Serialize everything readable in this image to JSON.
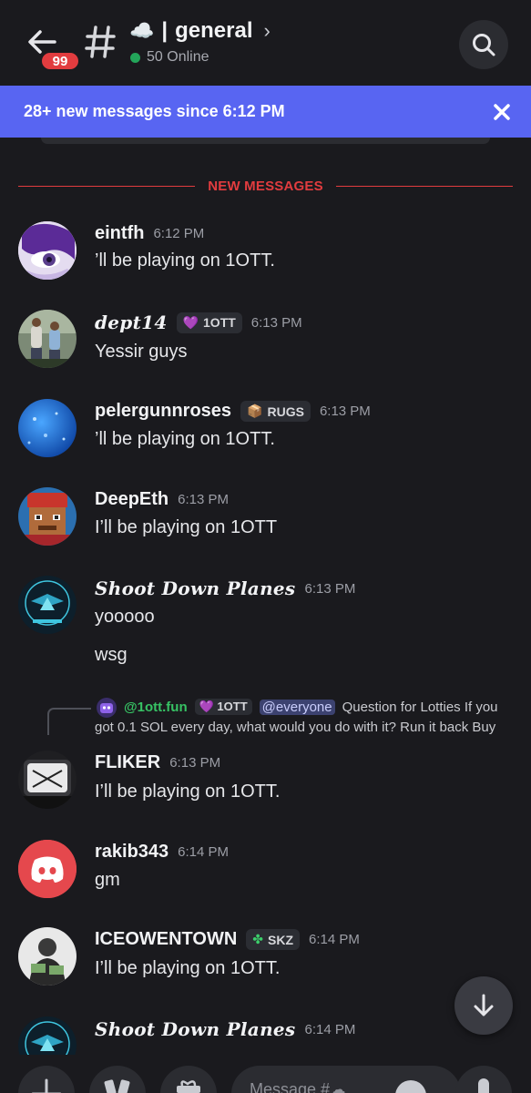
{
  "header": {
    "unread_count": "99",
    "channel_emoji": "☁️",
    "separator": "|",
    "channel_name": "general",
    "online_text": "50 Online"
  },
  "banner": {
    "text": "28+ new messages since 6:12 PM"
  },
  "divider": {
    "label": "NEW MESSAGES"
  },
  "messages": [
    {
      "username": "eintfh",
      "time": "6:12 PM",
      "lines": [
        "’ll be playing on 1OTT."
      ]
    },
    {
      "username": "dept14",
      "tag": "1OTT",
      "tag_icon": "purple-heart-icon",
      "time": "6:13 PM",
      "lines": [
        "Yessir guys"
      ]
    },
    {
      "username": "pelergunnroses",
      "tag": "RUGS",
      "tag_icon": "box-icon",
      "time": "6:13 PM",
      "lines": [
        "’ll be playing on 1OTT."
      ]
    },
    {
      "username": "DeepEth",
      "time": "6:13 PM",
      "lines": [
        "I’ll be playing on 1OTT"
      ]
    },
    {
      "username": "Shoot Down Planes",
      "time": "6:13 PM",
      "lines": [
        "yooooo",
        "wsg"
      ]
    },
    {
      "username": "FLIKER",
      "time": "6:13 PM",
      "lines": [
        "I’ll be playing on 1OTT."
      ]
    },
    {
      "username": "rakib343",
      "time": "6:14 PM",
      "lines": [
        "gm"
      ]
    },
    {
      "username": "ICEOWENTOWN",
      "tag": "SKZ",
      "tag_icon": "clover-icon",
      "time": "6:14 PM",
      "lines": [
        "I’ll be playing on 1OTT."
      ]
    },
    {
      "username": "Shoot Down Planes",
      "time": "6:14 PM",
      "lines": []
    }
  ],
  "reply": {
    "username": "@1ott.fun",
    "tag": "1OTT",
    "mention": "@everyone",
    "text1": "Question for Lotties If you",
    "text2": "got 0.1 SOL every day, what would you do with it? Run it back Buy"
  },
  "composer": {
    "placeholder": "Message #☁"
  },
  "colors": {
    "background": "#1a1a1e",
    "banner": "#5865f2",
    "new_messages": "#e23c3f",
    "online": "#23a55a"
  }
}
